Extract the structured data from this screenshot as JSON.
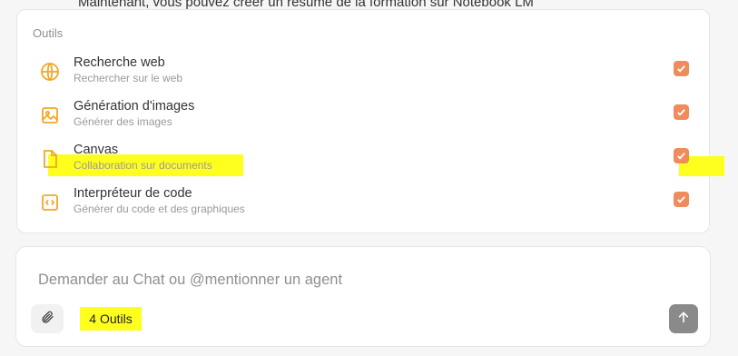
{
  "background_text": "Maintenant, vous pouvez créer un résumé de la formation sur Notebook LM",
  "tools": {
    "title": "Outils",
    "accent_color": "#f5a623",
    "check_color": "#f08b5b",
    "items": [
      {
        "name": "Recherche web",
        "description": "Rechercher sur le web",
        "icon": "globe-icon",
        "checked": true
      },
      {
        "name": "Génération d'images",
        "description": "Générer des images",
        "icon": "image-icon",
        "checked": true
      },
      {
        "name": "Canvas",
        "description": "Collaboration sur documents",
        "icon": "document-icon",
        "checked": true
      },
      {
        "name": "Interpréteur de code",
        "description": "Générer du code et des graphiques",
        "icon": "code-icon",
        "checked": true
      }
    ]
  },
  "composer": {
    "placeholder": "Demander au Chat ou @mentionner un agent",
    "tools_button_label": "4 Outils",
    "attach_icon": "paperclip-icon",
    "send_icon": "arrow-up-icon"
  }
}
